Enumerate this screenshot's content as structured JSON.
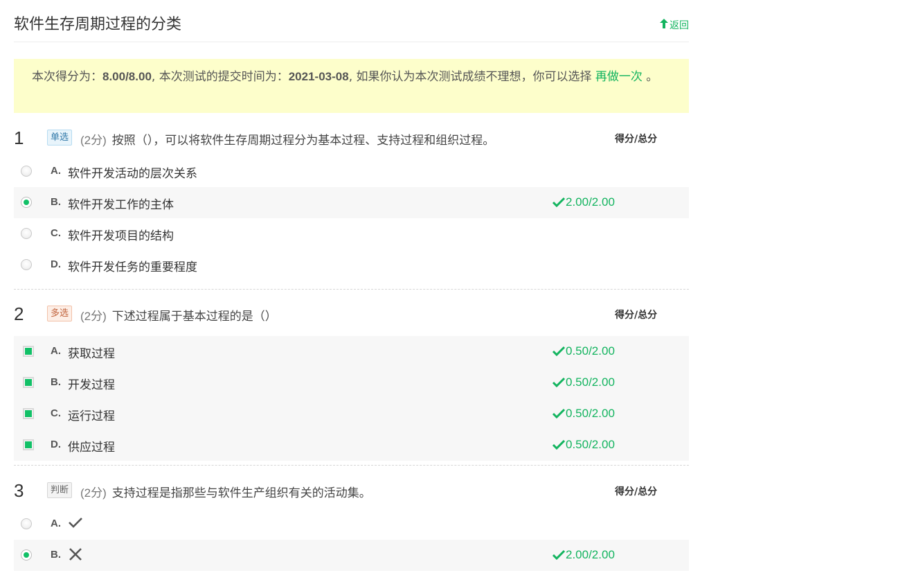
{
  "page": {
    "title": "软件生存周期过程的分类",
    "back_label": "返回"
  },
  "banner": {
    "prefix": "本次得分为：",
    "score": "8.00/8.00",
    "mid": ", 本次测试的提交时间为：",
    "date": "2021-03-08",
    "suffix": ", 如果你认为本次测试成绩不理想，你可以选择 ",
    "redo_label": "再做一次",
    "end": " 。"
  },
  "score_header_label": "得分/总分",
  "questions": [
    {
      "number": "1",
      "type_label": "单选",
      "points": "(2分)",
      "text": "按照（），可以将软件生存周期过程分为基本过程、支持过程和组织过程。",
      "options": [
        {
          "letter": "A.",
          "text": "软件开发活动的层次关系",
          "selected": false,
          "score": ""
        },
        {
          "letter": "B.",
          "text": "软件开发工作的主体",
          "selected": true,
          "score": "2.00/2.00"
        },
        {
          "letter": "C.",
          "text": "软件开发项目的结构",
          "selected": false,
          "score": ""
        },
        {
          "letter": "D.",
          "text": "软件开发任务的重要程度",
          "selected": false,
          "score": ""
        }
      ]
    },
    {
      "number": "2",
      "type_label": "多选",
      "points": "(2分)",
      "text": "下述过程属于基本过程的是（）",
      "options": [
        {
          "letter": "A.",
          "text": "获取过程",
          "selected": true,
          "score": "0.50/2.00"
        },
        {
          "letter": "B.",
          "text": "开发过程",
          "selected": true,
          "score": "0.50/2.00"
        },
        {
          "letter": "C.",
          "text": "运行过程",
          "selected": true,
          "score": "0.50/2.00"
        },
        {
          "letter": "D.",
          "text": "供应过程",
          "selected": true,
          "score": "0.50/2.00"
        }
      ]
    },
    {
      "number": "3",
      "type_label": "判断",
      "points": "(2分)",
      "text": "支持过程是指那些与软件生产组织有关的活动集。",
      "options": [
        {
          "letter": "A.",
          "icon": "check-icon",
          "selected": false,
          "score": ""
        },
        {
          "letter": "B.",
          "icon": "cross-icon",
          "selected": true,
          "score": "2.00/2.00"
        }
      ]
    }
  ],
  "colors": {
    "accent_green": "#13b45f",
    "banner_bg": "#fdfecb",
    "selected_row_bg": "#f7f7f7"
  }
}
